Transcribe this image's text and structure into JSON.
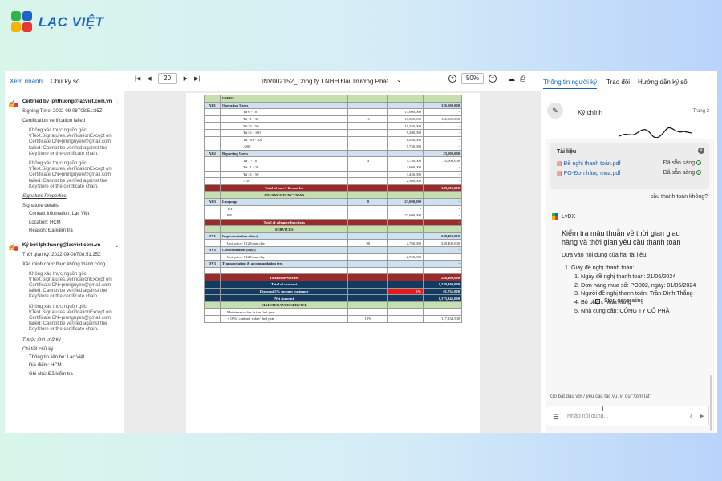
{
  "brand": {
    "name": "LẠC VIỆT",
    "colors": {
      "green": "#34b24a",
      "blue": "#1e63c6",
      "red": "#e53935",
      "yellow": "#f5b400",
      "teal": "#19a2b8"
    }
  },
  "left_tabs": [
    "Xem nhanh",
    "Chữ ký số"
  ],
  "toolbar": {
    "first_icon": "first-page-icon",
    "prev_icon": "prev-page-icon",
    "page": "20",
    "next_icon": "next-page-icon",
    "last_icon": "last-page-icon",
    "doc_title": "INV002152_Công ty TNHH Đại Trường Phát",
    "zoom": "50%"
  },
  "signatures": [
    {
      "header": "Certified by lphthuong@lacviet.com.vn",
      "time_line": "Signing Time: 2022-09-08T08:51:25Z",
      "status": "Certification verification failed",
      "messages": [
        "Không xác thực nguồn gốc. \\rText.Signatures.VerificationExcept on: Certificate CN=pmnguyen@gmail.com failed: Cannot be verified against the KeyStore or the certificate chain.",
        "Không xác thực nguồn gốc. \\rText.Signatures.VerificationExcept on: Certificate CN=pmnguyen@gmail.com failed: Cannot be verified against the KeyStore or the certificate chain."
      ],
      "link": "Signature Properties",
      "details_title": "Signature details",
      "details": [
        "Contact Infomation: Lạc Việt",
        "Location: HCM",
        "Reason: Đã kiểm tra"
      ]
    },
    {
      "header": "Ký bởi lphthuong@lacviet.com.vn",
      "time_line": "Thời gian ký: 2022-09-08T08:51:25Z",
      "status": "Xác minh chức thực không thành công",
      "messages": [
        "Không xác thực nguồn gốc. \\rText.Signatures.VerificationExcept on: Certificate CN=pmnguyen@gmail.com failed: Cannot be verified against the KeyStore or the certificate chain.",
        "Không xác thực nguồn gốc. \\rText.Signatures.VerificationExcept on: Certificate CN=pmnguyen@gmail.com failed: Cannot be verified against the KeyStore or the certificate chain."
      ],
      "link": "Thuộc tính chữ ký",
      "details_title": "Chi tiết chữ ký",
      "details": [
        "Thông tin liên hệ: Lạc Việt",
        "Địa điểm: HCM",
        "Ghi chú: Đã kiểm tra"
      ]
    }
  ],
  "sheet_rows": [
    {
      "t": "hdr",
      "c": [
        "",
        "USERS",
        "",
        "",
        ""
      ]
    },
    {
      "t": "sub",
      "c": [
        "AD1",
        "Operation Users",
        "",
        "",
        "126,500,000"
      ]
    },
    {
      "t": "",
      "c": [
        "",
        "Từ 6 - 10",
        "",
        "13,000,000",
        "-"
      ]
    },
    {
      "t": "",
      "c": [
        "",
        "Từ 11 - 30",
        "11",
        "11,500,000",
        "126,500,000"
      ]
    },
    {
      "t": "",
      "c": [
        "",
        "Từ 31 - 50",
        "",
        "10,350,000",
        "-"
      ]
    },
    {
      "t": "",
      "c": [
        "",
        "Từ 51 - 100",
        "",
        "9,200,000",
        "-"
      ]
    },
    {
      "t": "",
      "c": [
        "",
        "Từ 101 - 200",
        "",
        "8,050,000",
        "-"
      ]
    },
    {
      "t": "",
      "c": [
        "",
        ">200",
        "",
        "5,750,000",
        "-"
      ]
    },
    {
      "t": "sub",
      "c": [
        "AD2",
        "Reporting Users",
        "",
        "",
        "23,000,000"
      ]
    },
    {
      "t": "",
      "c": [
        "",
        "Từ 1 - 10",
        "4",
        "5,750,000",
        "23,000,000"
      ]
    },
    {
      "t": "",
      "c": [
        "",
        "Từ 11 - 20",
        "",
        "4,600,000",
        "-"
      ]
    },
    {
      "t": "",
      "c": [
        "",
        "Từ 21 - 50",
        "",
        "3,450,000",
        "-"
      ]
    },
    {
      "t": "",
      "c": [
        "",
        "> 50",
        "",
        "2,300,000",
        "-"
      ]
    },
    {
      "t": "red",
      "c": [
        "",
        "Total of user's license fee",
        "",
        "",
        "149,500,000"
      ]
    },
    {
      "t": "sec",
      "c": [
        "",
        "ADVANCE FUNCTIONS",
        "",
        "",
        ""
      ]
    },
    {
      "t": "sub",
      "c": [
        "AD3",
        "Language",
        "0",
        "23,000,000",
        "-"
      ]
    },
    {
      "t": "",
      "c": [
        "",
        "VN",
        "",
        "-",
        "-"
      ]
    },
    {
      "t": "",
      "c": [
        "",
        "EN",
        "",
        "27,600,000",
        "-"
      ]
    },
    {
      "t": "red",
      "c": [
        "",
        "Total of advance functions",
        "",
        "",
        "-"
      ]
    },
    {
      "t": "sec",
      "c": [
        "",
        "SERVICES",
        "",
        "",
        ""
      ]
    },
    {
      "t": "sub",
      "c": [
        "DV1",
        "Implementation (days)",
        "",
        "",
        "248,400,000"
      ]
    },
    {
      "t": "",
      "c": [
        "",
        "Unit price: $120/man day",
        "90",
        "2,760,000",
        "248,400,000"
      ]
    },
    {
      "t": "sub",
      "c": [
        "DV2",
        "Customization (days)",
        "",
        "",
        "-"
      ]
    },
    {
      "t": "",
      "c": [
        "",
        "Unit price: $120/man day",
        "-",
        "2,760,000",
        "-"
      ]
    },
    {
      "t": "sub",
      "c": [
        "DV3",
        "Transportation & accommodation fees",
        "",
        "",
        "-"
      ]
    },
    {
      "t": "",
      "c": [
        "",
        "",
        "",
        "",
        "-"
      ]
    },
    {
      "t": "red",
      "c": [
        "",
        "Total of service fee",
        "",
        "",
        "248,400,000"
      ]
    },
    {
      "t": "navy",
      "c": [
        "",
        "Total of contract",
        "",
        "",
        "1,239,100,000"
      ]
    },
    {
      "t": "navy",
      "c": [
        "",
        "Discount 5% for new customer",
        "",
        "5%",
        "61,755,000"
      ],
      "hot": 3
    },
    {
      "t": "navy",
      "c": [
        "",
        "Net Amount",
        "",
        "",
        "1,173,345,000"
      ]
    },
    {
      "t": "sec",
      "c": [
        "",
        "MAINTENANCE SERVICE",
        "",
        "",
        ""
      ]
    },
    {
      "t": "",
      "c": [
        "",
        "Maintenance fee in the first year",
        "",
        "",
        ""
      ]
    },
    {
      "t": "",
      "c": [
        "",
        "+ 10%/ contract value/ 2nd year",
        "10%",
        "",
        "117,334,500"
      ]
    }
  ],
  "right_tabs": [
    "Thông tin người ký",
    "Trao đổi",
    "Hướng dẫn ký số"
  ],
  "sign_panel": {
    "title": "Ký chính",
    "page": "Trang 2"
  },
  "chat": {
    "attach_title": "Tài liệu",
    "files": [
      {
        "name": "Đề nghị thanh toán.pdf",
        "status": "Đã sẵn sàng"
      },
      {
        "name": "PO-Đơn hàng mua.pdf",
        "status": "Đã sẵn sàng"
      }
    ],
    "question": "cầu thanh toán không?",
    "bot_name": "LvDX",
    "answer_title": "Kiểm tra mâu thuẫn về thời gian giao hàng và thời gian yêu cầu thanh toán",
    "answer_intro": "Dựa vào nội dung của hai tài liệu:",
    "outer_item": "Giấy đề nghị thanh toán:",
    "inner_items": [
      "Ngày đề nghị thanh toán: 21/06/2024",
      "Đơn hàng mua số: PO002, ngày: 01/05/2024",
      "Người đề nghị thanh toán: Trần Đình Thắng",
      "Bộ phận: Mua hàng",
      "Nhà cung cấp: CÔNG TY CỔ PHẦ"
    ],
    "stop_label": "Stop generating",
    "hint": "Gõ bắt đầu với / yêu cầu tác vụ, ví dụ \"/tóm tắt\"",
    "placeholder": "Nhập nội dung..."
  }
}
